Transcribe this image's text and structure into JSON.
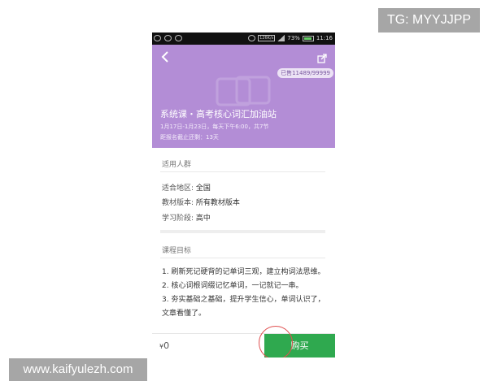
{
  "overlay": {
    "tg_label": "TG: MYYJJPP",
    "site_label": "www.kaifyulezh.com"
  },
  "statusbar": {
    "network_speed": "126K/s",
    "battery": "73%",
    "time": "11:16"
  },
  "header": {
    "sold": "已售11489/99999",
    "title": "系统课・高考核心词汇加油站",
    "schedule": "1月17日-1月23日，每天下午6:00，共7节",
    "deadline": "距报名截止还剩：13天",
    "accent": "#b38dd6"
  },
  "audience": {
    "heading": "适用人群",
    "rows": [
      {
        "label": "适合地区:",
        "value": "全国"
      },
      {
        "label": "教材版本:",
        "value": "所有教材版本"
      },
      {
        "label": "学习阶段:",
        "value": "高中"
      }
    ]
  },
  "goals": {
    "heading": "课程目标",
    "items": [
      "1. 刷新死记硬背的记单词三观，建立构词法思维。",
      "2. 核心词根词缀记忆单词，一记就记一串。",
      "3. 夯实基础之基础，提升学生信心，单词认识了，文章看懂了。"
    ]
  },
  "bottom": {
    "currency": "¥",
    "price": "0",
    "buy_label": "购买",
    "buy_color": "#2fa94f"
  },
  "icons": {
    "back": "back-arrow-icon",
    "share": "share-icon"
  }
}
